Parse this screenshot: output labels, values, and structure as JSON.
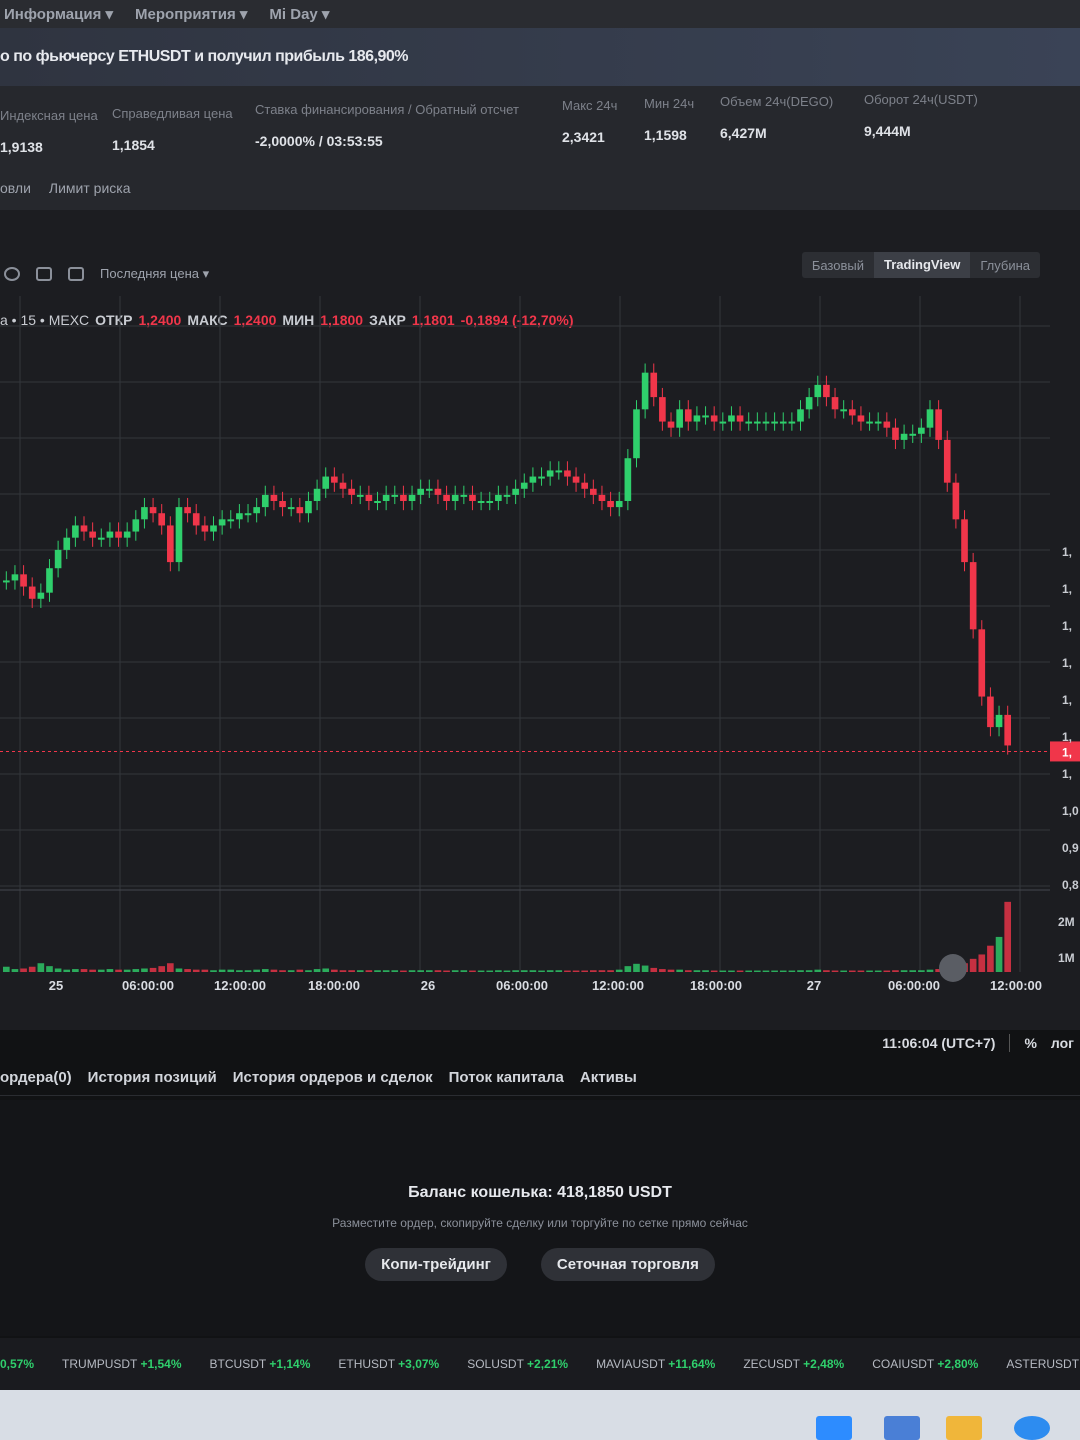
{
  "nav": {
    "items": [
      "Информация ▾",
      "Мероприятия ▾",
      "Mi Day ▾"
    ]
  },
  "banner": {
    "text": "о по фьючерсу ETHUSDT и получил прибыль 186,90%"
  },
  "stats": [
    {
      "label": "Индексная цена",
      "value": "1,9138"
    },
    {
      "label": "Справедливая цена",
      "value": "1,1854"
    },
    {
      "label": "Ставка финансирования / Обратный отсчет",
      "value": "-2,0000% / 03:53:55"
    },
    {
      "label": "Макс 24ч",
      "value": "2,3421"
    },
    {
      "label": "Мин 24ч",
      "value": "1,1598"
    },
    {
      "label": "Объем 24ч(DEGO)",
      "value": "6,427M"
    },
    {
      "label": "Оборот 24ч(USDT)",
      "value": "9,444M"
    }
  ],
  "subtabs": [
    "овли",
    "Лимит риска"
  ],
  "toolbar": {
    "price_type": "Последняя цена ▾"
  },
  "viewtabs": [
    "Базовый",
    "TradingView",
    "Глубина"
  ],
  "legend": {
    "symbol": "a • 15 • MEXC",
    "open_label": "ОТКР",
    "open": "1,2400",
    "high_label": "МАКС",
    "high": "1,2400",
    "low_label": "МИН",
    "low": "1,1800",
    "close_label": "ЗАКР",
    "close": "1,1801",
    "change": "-0,1894 (-12,70%)"
  },
  "chart_data": {
    "type": "candlestick",
    "price_axis_labels": [
      "1,",
      "1,",
      "1,",
      "1,",
      "1,",
      "1,",
      "1,",
      "1,0",
      "0,9",
      "0,8"
    ],
    "current_price_tag": "1,",
    "volume_axis_labels": [
      "2M",
      "1M"
    ],
    "time_labels": [
      "25",
      "06:00:00",
      "12:00:00",
      "18:00:00",
      "26",
      "06:00:00",
      "12:00:00",
      "18:00:00",
      "27",
      "06:00:00",
      "12:00:00"
    ],
    "series": [
      {
        "values": [
          1.32,
          1.33,
          1.31,
          1.29,
          1.3,
          1.34,
          1.37,
          1.39,
          1.41,
          1.4,
          1.39,
          1.39,
          1.4,
          1.39,
          1.4,
          1.42,
          1.44,
          1.43,
          1.41,
          1.35,
          1.44,
          1.43,
          1.41,
          1.4,
          1.41,
          1.42,
          1.42,
          1.43,
          1.43,
          1.44,
          1.46,
          1.45,
          1.44,
          1.44,
          1.43,
          1.45,
          1.47,
          1.49,
          1.48,
          1.47,
          1.46,
          1.46,
          1.45,
          1.45,
          1.46,
          1.46,
          1.45,
          1.46,
          1.47,
          1.47,
          1.46,
          1.45,
          1.46,
          1.46,
          1.45,
          1.45,
          1.45,
          1.46,
          1.46,
          1.47,
          1.48,
          1.49,
          1.49,
          1.5,
          1.5,
          1.49,
          1.48,
          1.47,
          1.46,
          1.45,
          1.44,
          1.45,
          1.52,
          1.6,
          1.66,
          1.62,
          1.58,
          1.57,
          1.6,
          1.58,
          1.59,
          1.59,
          1.58,
          1.58,
          1.59,
          1.58,
          1.58,
          1.58,
          1.58,
          1.58,
          1.58,
          1.58,
          1.6,
          1.62,
          1.64,
          1.62,
          1.6,
          1.6,
          1.59,
          1.58,
          1.58,
          1.58,
          1.57,
          1.55,
          1.56,
          1.56,
          1.57,
          1.6,
          1.55,
          1.48,
          1.42,
          1.35,
          1.24,
          1.13,
          1.08,
          1.1,
          1.05
        ]
      }
    ],
    "volume": [
      0.18,
      0.1,
      0.12,
      0.18,
      0.3,
      0.2,
      0.12,
      0.08,
      0.1,
      0.1,
      0.08,
      0.08,
      0.1,
      0.08,
      0.08,
      0.1,
      0.12,
      0.14,
      0.2,
      0.3,
      0.12,
      0.1,
      0.08,
      0.08,
      0.06,
      0.08,
      0.08,
      0.06,
      0.06,
      0.08,
      0.1,
      0.08,
      0.06,
      0.06,
      0.08,
      0.06,
      0.1,
      0.12,
      0.08,
      0.06,
      0.06,
      0.06,
      0.06,
      0.06,
      0.06,
      0.06,
      0.05,
      0.06,
      0.06,
      0.06,
      0.06,
      0.05,
      0.06,
      0.06,
      0.05,
      0.05,
      0.05,
      0.06,
      0.05,
      0.06,
      0.06,
      0.06,
      0.05,
      0.06,
      0.06,
      0.05,
      0.05,
      0.05,
      0.06,
      0.06,
      0.06,
      0.08,
      0.2,
      0.28,
      0.22,
      0.14,
      0.1,
      0.08,
      0.08,
      0.06,
      0.06,
      0.06,
      0.05,
      0.05,
      0.05,
      0.05,
      0.05,
      0.05,
      0.05,
      0.05,
      0.05,
      0.05,
      0.06,
      0.06,
      0.08,
      0.06,
      0.05,
      0.05,
      0.05,
      0.05,
      0.05,
      0.05,
      0.05,
      0.06,
      0.06,
      0.06,
      0.06,
      0.08,
      0.1,
      0.15,
      0.2,
      0.3,
      0.45,
      0.6,
      0.9,
      1.2,
      2.4
    ]
  },
  "timebar": {
    "time": "11:06:04 (UTC+7)",
    "percent": "%",
    "log": "лог"
  },
  "order_tabs": [
    "ордера(0)",
    "История позиций",
    "История ордеров и сделок",
    "Поток капитала",
    "Активы"
  ],
  "empty_state": {
    "balance": "Баланс кошелька: 418,1850 USDT",
    "hint": "Разместите ордер, скопируйте сделку или торгуйте по сетке прямо сейчас",
    "buttons": [
      "Копи-трейдинг",
      "Сеточная торговля"
    ]
  },
  "ticker": [
    {
      "sym": "",
      "chg": "0,57%",
      "dir": "up"
    },
    {
      "sym": "TRUMPUSDT",
      "chg": "+1,54%",
      "dir": "up"
    },
    {
      "sym": "BTCUSDT",
      "chg": "+1,14%",
      "dir": "up"
    },
    {
      "sym": "ETHUSDT",
      "chg": "+3,07%",
      "dir": "up"
    },
    {
      "sym": "SOLUSDT",
      "chg": "+2,21%",
      "dir": "up"
    },
    {
      "sym": "MAVIAUSDT",
      "chg": "+11,64%",
      "dir": "up"
    },
    {
      "sym": "ZECUSDT",
      "chg": "+2,48%",
      "dir": "up"
    },
    {
      "sym": "COAIUSDT",
      "chg": "+2,80%",
      "dir": "up"
    },
    {
      "sym": "ASTERUSDT",
      "chg": "-0,60%",
      "dir": "dn"
    }
  ],
  "colors": {
    "up": "#2fcf6c",
    "down": "#f0364a",
    "grid": "#33363c"
  }
}
